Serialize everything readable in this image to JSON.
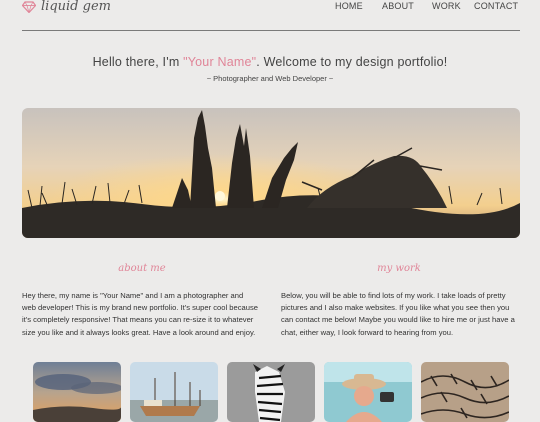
{
  "brand": {
    "logo_text": "liquid gem",
    "accent": "#e08598"
  },
  "nav": {
    "items": [
      "HOME",
      "ABOUT",
      "WORK",
      "CONTACT"
    ]
  },
  "headline": {
    "prefix": "Hello there, I'm ",
    "name": "\"Your Name\"",
    "suffix": ". Welcome to my design portfolio!",
    "subtitle": "~ Photographer and Web Developer ~"
  },
  "hero": {
    "icon": "sunset-landscape-photo"
  },
  "about": {
    "title": "about me",
    "text": "Hey there, my name is \"Your Name\" and I am a photographer and web developer! This is my brand new portfolio. It's super cool because it's completely responsive! That means you can re-size it to whatever size you like and it always looks great. Have a look around and enjoy."
  },
  "work": {
    "title": "my work",
    "text": "Below, you will be able to find lots of my work. I take loads of pretty pictures and I also make websites. If you like what you see then you can contact me below! Maybe you would like to hire me or just have a chat, either way, I look forward to hearing from you."
  },
  "thumbnails": [
    "sunset-sky-photo",
    "harbor-boats-photo",
    "zebra-photo",
    "cowboy-hat-man-photo",
    "barbed-wire-photo"
  ]
}
